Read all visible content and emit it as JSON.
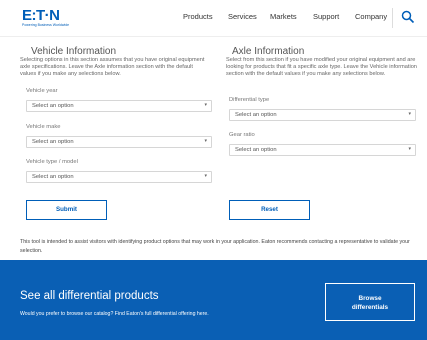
{
  "header": {
    "logo_text": "E:T·N",
    "logo_tagline": "Powering Business Worldwide",
    "nav": [
      "Products",
      "Services",
      "Markets",
      "Support",
      "Company"
    ],
    "search_icon": "search-icon"
  },
  "vehicle": {
    "title": "Vehicle Information",
    "description": "Selecting options in this section assumes that you have original equipment axle specifications. Leave the Axle information section with the default values if you make any selections below.",
    "fields": [
      {
        "label": "Vehicle year",
        "value": "Select an option"
      },
      {
        "label": "Vehicle make",
        "value": "Select an option"
      },
      {
        "label": "Vehicle type / model",
        "value": "Select an option"
      }
    ],
    "submit_label": "Submit"
  },
  "axle": {
    "title": "Axle Information",
    "description": "Select from this section if you have modified your original equipment and are looking for products that fit a specific axle type. Leave the Vehicle information section with the default values if you make any selections below.",
    "fields": [
      {
        "label": "Differential type",
        "value": "Select an option"
      },
      {
        "label": "Gear ratio",
        "value": "Select an option"
      }
    ],
    "reset_label": "Reset"
  },
  "notice": "This tool is intended to assist visitors with identifying product options that may work in your application. Eaton recommends contacting a representative to validate your selection.",
  "banner": {
    "title": "See all differential products",
    "subtitle": "Would you prefer to browse our catalog? Find Eaton's full differential offering here.",
    "button_line1": "Browse",
    "button_line2": "differentials"
  },
  "colors": {
    "brand": "#005eb8",
    "banner": "#0a5fb4"
  }
}
